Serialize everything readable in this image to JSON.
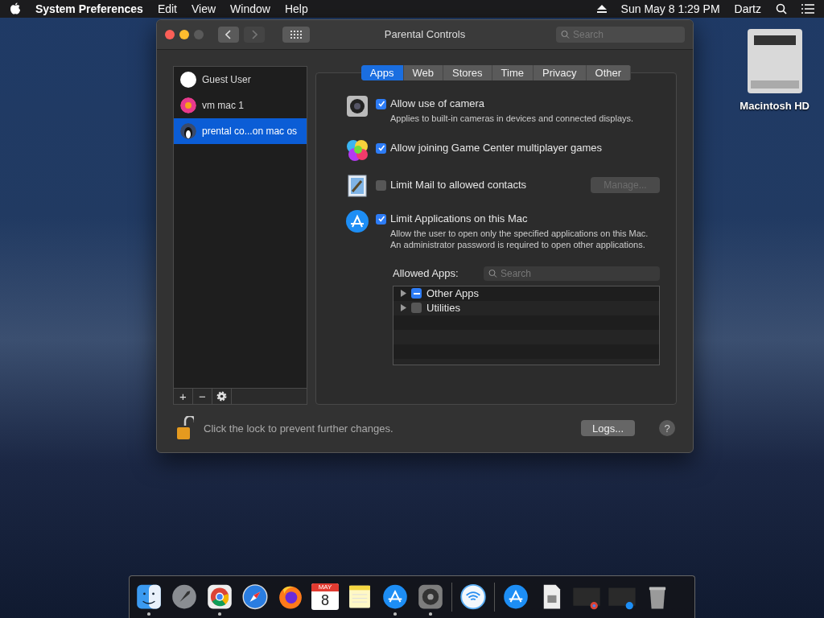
{
  "menubar": {
    "app_name": "System Preferences",
    "menus": [
      "Edit",
      "View",
      "Window",
      "Help"
    ],
    "clock": "Sun May 8  1:29 PM",
    "user": "Dartz"
  },
  "window": {
    "title": "Parental Controls",
    "search_placeholder": "Search"
  },
  "users": [
    {
      "name": "Guest User",
      "selected": false
    },
    {
      "name": "vm mac 1",
      "selected": false
    },
    {
      "name": "prental co...on mac os",
      "selected": true
    }
  ],
  "list_buttons": [
    "+",
    "−"
  ],
  "tabs": [
    {
      "label": "Apps",
      "selected": true
    },
    {
      "label": "Web",
      "selected": false
    },
    {
      "label": "Stores",
      "selected": false
    },
    {
      "label": "Time",
      "selected": false
    },
    {
      "label": "Privacy",
      "selected": false
    },
    {
      "label": "Other",
      "selected": false
    }
  ],
  "options": [
    {
      "label": "Allow use of camera",
      "checked": true,
      "description": "Applies to built-in cameras in devices and connected displays."
    },
    {
      "label": "Allow joining Game Center multiplayer games",
      "checked": true
    },
    {
      "label": "Limit Mail to allowed contacts",
      "checked": false,
      "button": {
        "label": "Manage...",
        "disabled": true
      }
    },
    {
      "label": "Limit Applications on this Mac",
      "checked": true,
      "description": "Allow the user to open only the specified applications on this Mac. An administrator password is required to open other applications."
    }
  ],
  "allowed_apps": {
    "label": "Allowed Apps:",
    "search_placeholder": "Search",
    "rows": [
      {
        "label": "Other Apps",
        "mixed": true,
        "expanded": false
      },
      {
        "label": "Utilities",
        "mixed": false,
        "expanded": false
      }
    ]
  },
  "lock": {
    "locked": false,
    "text": "Click the lock to prevent further changes."
  },
  "logs_button": "Logs...",
  "help_button": "?",
  "desktop_icon": "Macintosh HD",
  "dock": [
    {
      "running": true
    },
    {
      "running": false
    },
    {
      "running": true
    },
    {
      "running": false
    },
    {
      "running": false
    },
    {
      "running": false,
      "month": "MAY",
      "day": "8"
    },
    {
      "running": false
    },
    {
      "running": true
    },
    {
      "running": true
    },
    {
      "running": false
    },
    {
      "running": false
    },
    {
      "running": false
    },
    {
      "running": false
    },
    {
      "running": false
    },
    {
      "running": false
    }
  ]
}
